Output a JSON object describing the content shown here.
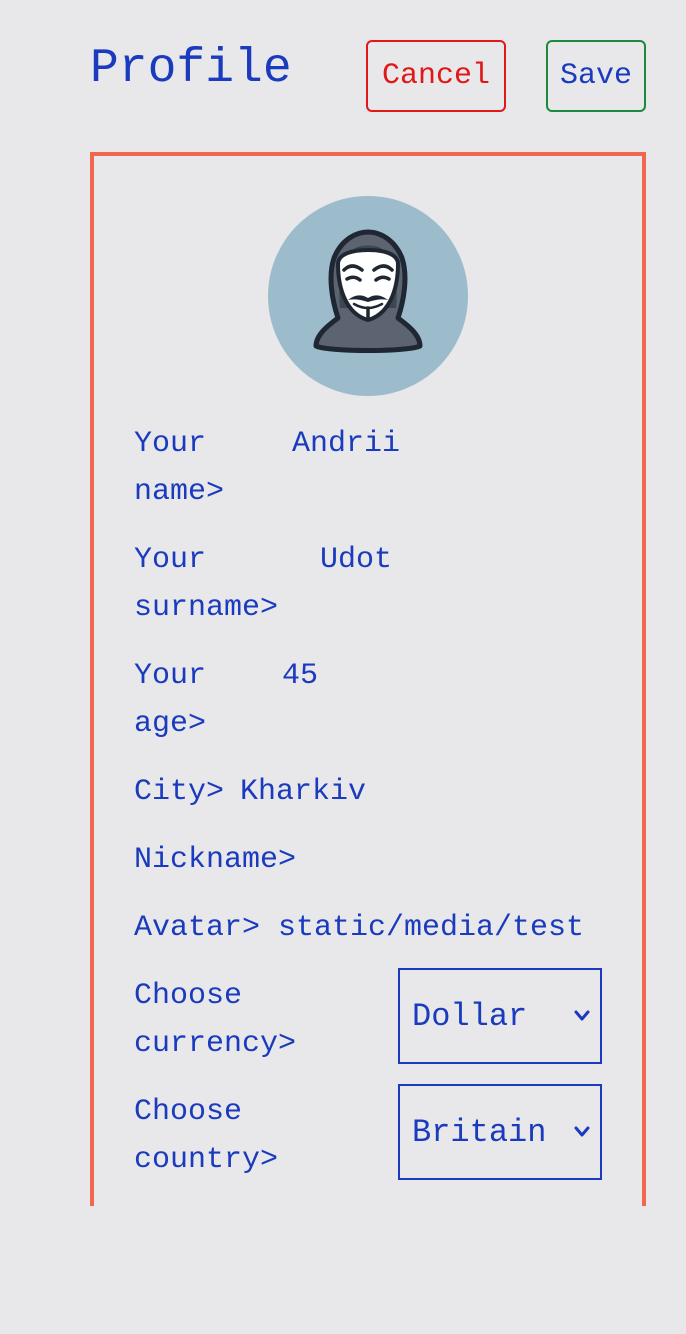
{
  "header": {
    "title": "Profile",
    "cancel_label": "Cancel",
    "save_label": "Save"
  },
  "form": {
    "name_label": "Your\nname>",
    "name_value": "Andrii",
    "surname_label": "Your\nsurname>",
    "surname_value": "Udot",
    "age_label": "Your\nage>",
    "age_value": "45",
    "city_label": "City>",
    "city_value": "Kharkiv",
    "nickname_label": "Nickname>",
    "nickname_value": "",
    "avatar_label": "Avatar>",
    "avatar_value": "static/media/test",
    "currency_label": "Choose\ncurrency>",
    "currency_value": "Dollar",
    "country_label": "Choose\ncountry>",
    "country_value": "Britain"
  },
  "colors": {
    "background": "#e8e7ea",
    "text": "#1a3bbd",
    "panel_border": "#f0664e",
    "cancel": "#e01818",
    "save_border": "#1c8a3c",
    "avatar_bg": "#9cbccc"
  },
  "icons": {
    "avatar": "anonymous-mask-avatar-icon",
    "select_arrow": "chevron-down-icon"
  }
}
